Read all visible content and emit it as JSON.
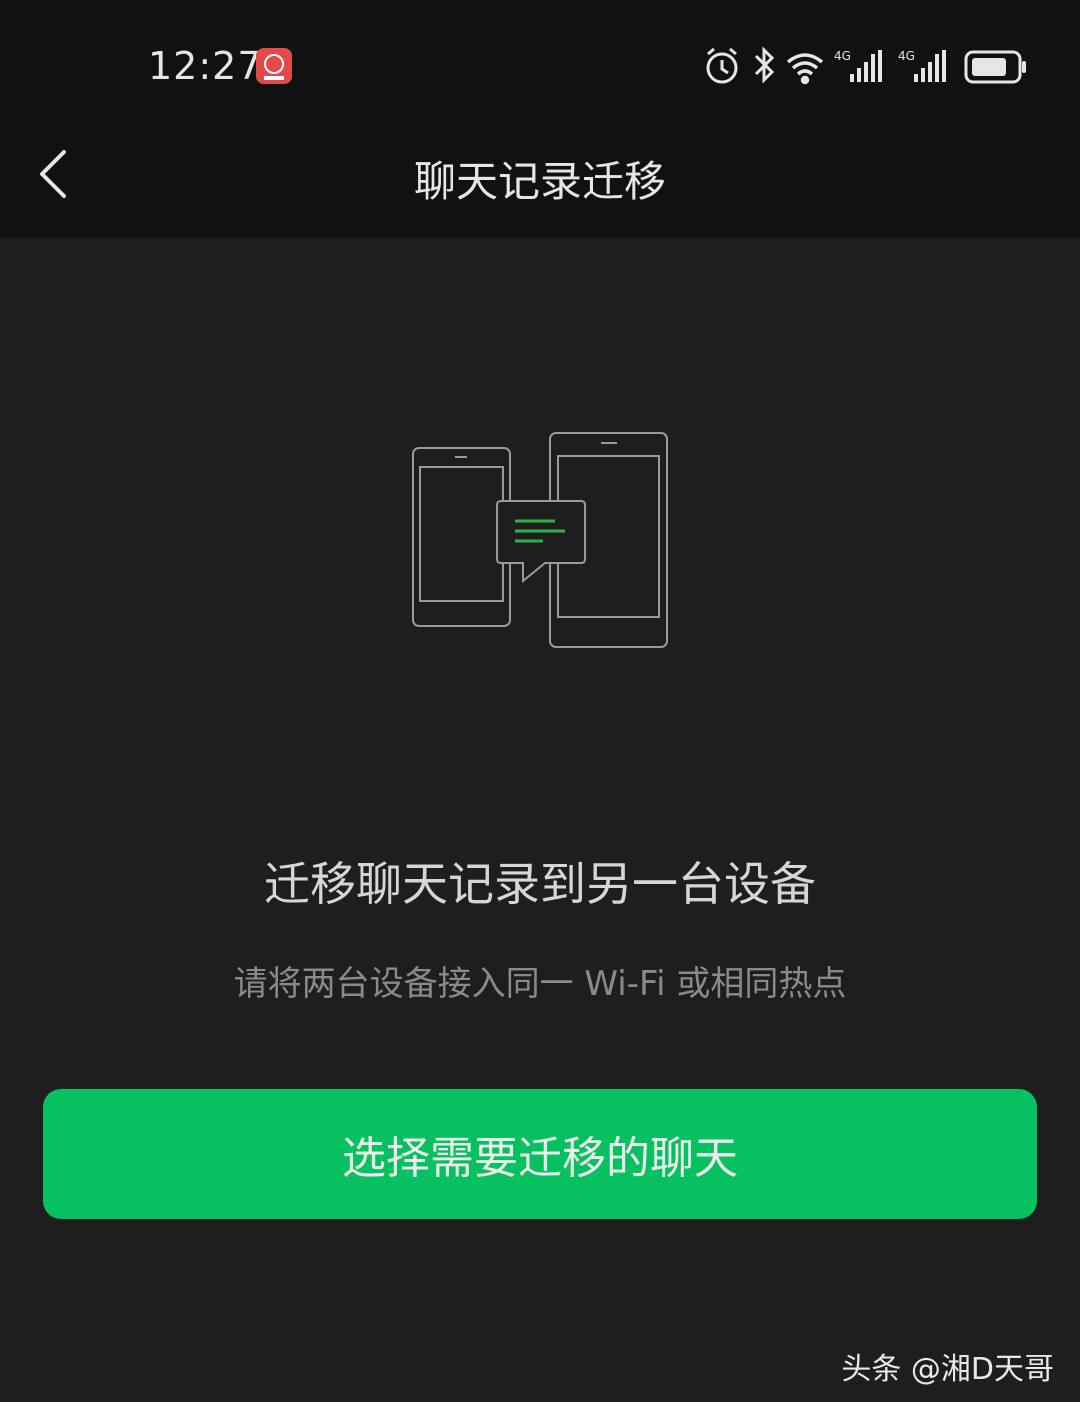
{
  "status_bar": {
    "time": "12:27",
    "network_1": "4G",
    "network_2": "4G",
    "icons": [
      "alarm-icon",
      "bluetooth-icon",
      "wifi-icon",
      "signal-icon",
      "signal-icon",
      "battery-icon"
    ]
  },
  "nav": {
    "title": "聊天记录迁移",
    "back_icon": "chevron-left-icon"
  },
  "main": {
    "headline": "迁移聊天记录到另一台设备",
    "subtext": "请将两台设备接入同一 Wi-Fi 或相同热点",
    "primary_button": "选择需要迁移的聊天"
  },
  "watermark": "头条 @湘D天哥",
  "colors": {
    "background": "#1e1e1e",
    "topbar": "#111111",
    "accent": "#07c160",
    "illustration_line": "#9a9a9a",
    "bubble_line": "#2fb14a"
  }
}
